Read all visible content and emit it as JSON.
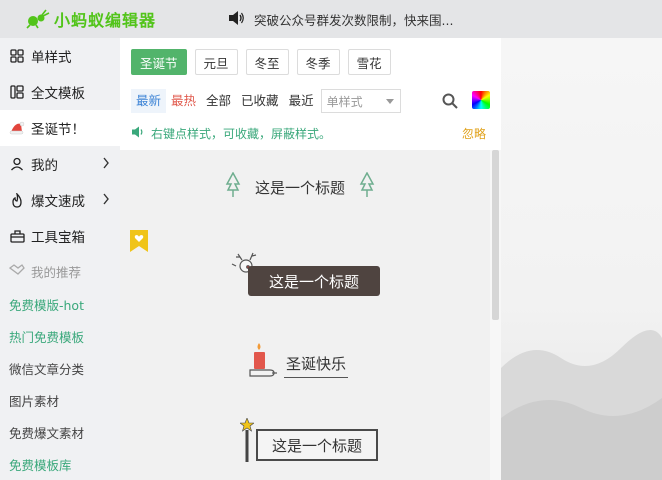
{
  "app": {
    "logo_text": "小蚂蚁编辑器"
  },
  "notice": {
    "text": "突破公众号群发次数限制，快来围..."
  },
  "sidebar": {
    "items": [
      {
        "label": "单样式",
        "icon": "grid-icon"
      },
      {
        "label": "全文模板",
        "icon": "template-icon"
      },
      {
        "label": "圣诞节！",
        "icon": "santa-hat-icon"
      },
      {
        "label": "我的",
        "icon": "user-icon"
      },
      {
        "label": "爆文速成",
        "icon": "flame-icon"
      },
      {
        "label": "工具宝箱",
        "icon": "toolbox-icon"
      }
    ],
    "recommend_title": "我的推荐",
    "recommend": [
      {
        "label": "免费模版-hot",
        "accent": true
      },
      {
        "label": "热门免费模板",
        "accent": true
      },
      {
        "label": "微信文章分类",
        "accent": false
      },
      {
        "label": "图片素材",
        "accent": false
      },
      {
        "label": "免费爆文素材",
        "accent": false
      },
      {
        "label": "免费模板库",
        "accent": true
      }
    ]
  },
  "tabs": [
    "圣诞节",
    "元旦",
    "冬至",
    "冬季",
    "雪花"
  ],
  "filters": [
    "最新",
    "最热",
    "全部",
    "已收藏",
    "最近"
  ],
  "select": {
    "value": "单样式"
  },
  "hint": {
    "text": "右键点样式，可收藏，屏蔽样式。",
    "ignore": "忽略"
  },
  "samples": {
    "title1": "这是一个标题",
    "title2": "这是一个标题",
    "title3": "圣诞快乐",
    "title4": "这是一个标题"
  },
  "colors": {
    "accent_green": "#52b46b",
    "hint_green": "#3aa87b",
    "hot_red": "#e05a4d",
    "new_blue": "#3d84d6",
    "ignore_orange": "#e0a11a"
  }
}
